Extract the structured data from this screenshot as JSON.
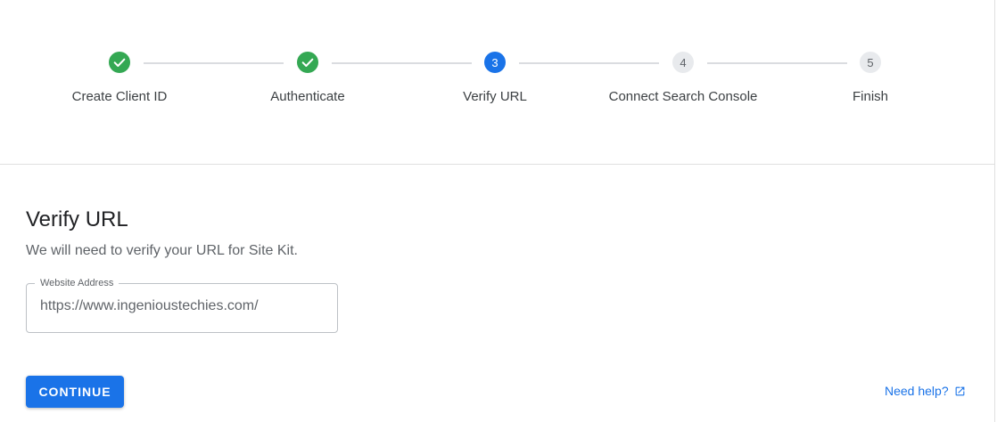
{
  "stepper": {
    "steps": [
      {
        "number": "1",
        "label": "Create Client ID",
        "state": "done",
        "icon": "check-icon"
      },
      {
        "number": "2",
        "label": "Authenticate",
        "state": "done",
        "icon": "check-icon"
      },
      {
        "number": "3",
        "label": "Verify URL",
        "state": "active"
      },
      {
        "number": "4",
        "label": "Connect Search Console",
        "state": "todo"
      },
      {
        "number": "5",
        "label": "Finish",
        "state": "todo"
      }
    ]
  },
  "main": {
    "title": "Verify URL",
    "description": "We will need to verify your URL for Site Kit.",
    "website_field": {
      "label": "Website Address",
      "value": "https://www.ingenioustechies.com/"
    },
    "continue_label": "CONTINUE",
    "help_label": "Need help?",
    "help_icon": "external-link-icon"
  },
  "colors": {
    "done": "#34a853",
    "active": "#1a73e8",
    "todo": "#e8eaed",
    "accent": "#1a73e8"
  }
}
